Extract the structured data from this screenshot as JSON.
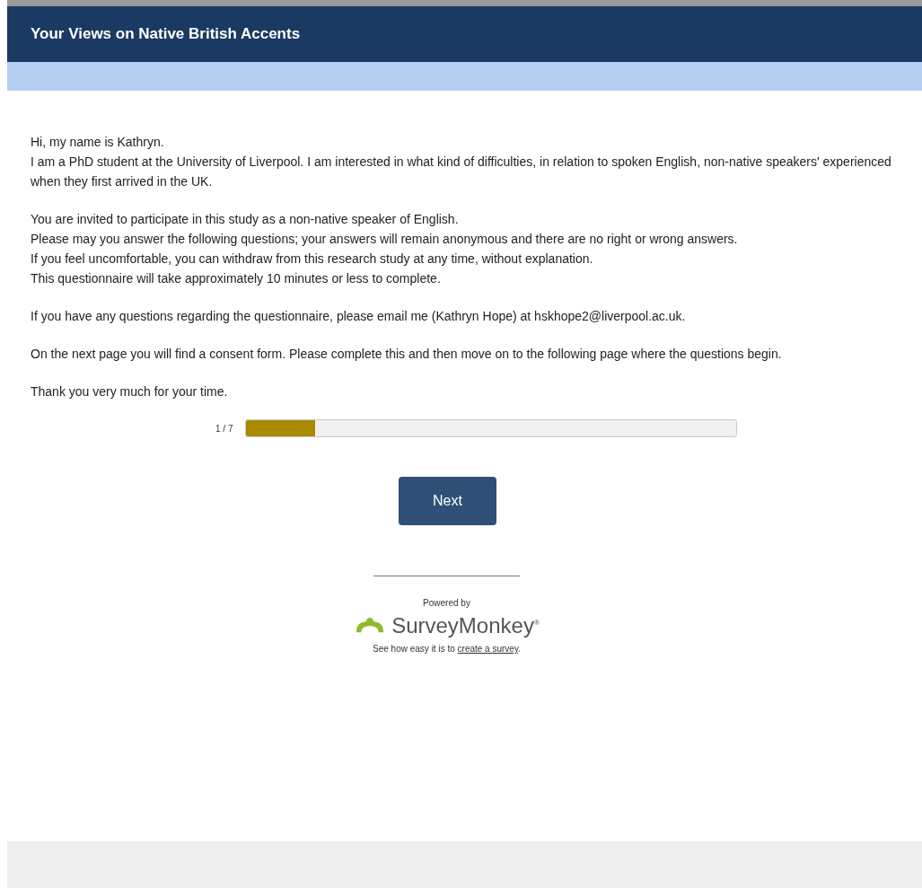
{
  "header": {
    "title": "Your Views on Native British Accents"
  },
  "intro": [
    [
      "Hi, my name is Kathryn.",
      "I am a PhD student at the University of Liverpool. I am interested in what kind of difficulties, in relation to spoken English, non-native speakers' experienced when they first arrived in the UK."
    ],
    [
      "You are invited to participate in this study as a non-native speaker of English.",
      "Please may you answer the following questions; your answers will remain anonymous and there are no right or wrong answers.",
      "If you feel uncomfortable, you can withdraw from this research study at any time, without explanation.",
      "This questionnaire will take approximately 10 minutes or less to complete."
    ],
    [
      "If you have any questions regarding the questionnaire, please email me (Kathryn Hope) at hskhope2@liverpool.ac.uk."
    ],
    [
      "On the next page you will find a consent form. Please complete this and then move on to the following page where the questions begin."
    ],
    [
      "Thank you very much for your time."
    ]
  ],
  "progress": {
    "label": "1 / 7",
    "level": 0.14
  },
  "next_button": "Next",
  "footer": {
    "powered_by": "Powered by",
    "brand": "SurveyMonkey$^{®}$",
    "tagline_before": "See how easy it is to",
    "link": "create a survey",
    "tagline_after": "."
  }
}
